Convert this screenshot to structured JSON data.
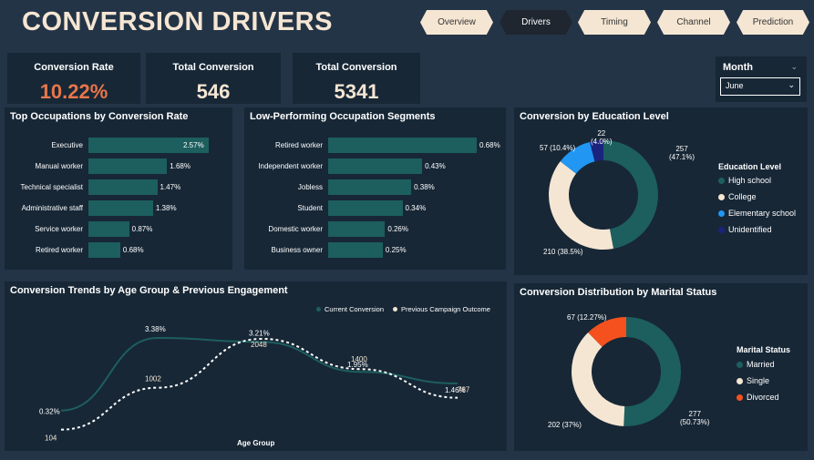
{
  "title": "CONVERSION DRIVERS",
  "nav": [
    "Overview",
    "Drivers",
    "Timing",
    "Channel",
    "Prediction"
  ],
  "nav_active": "Drivers",
  "kpis": [
    {
      "label": "Conversion Rate",
      "value": "10.22%"
    },
    {
      "label": "Total Conversion",
      "value": "546"
    },
    {
      "label": "Total Conversion",
      "value": "5341"
    }
  ],
  "filter": {
    "label": "Month",
    "value": "June"
  },
  "colors": {
    "teal": "#1d5e5e",
    "cream": "#f5e6d3",
    "blue": "#2196f3",
    "navy": "#1a237e",
    "orange": "#e8764a",
    "red": "#f4511e"
  },
  "top_occ": {
    "title": "Top Occupations by Conversion Rate",
    "chart_data": {
      "type": "bar",
      "categories": [
        "Executive",
        "Manual worker",
        "Technical specialist",
        "Administrative staff",
        "Service worker",
        "Retired worker"
      ],
      "values": [
        2.57,
        1.68,
        1.47,
        1.38,
        0.87,
        0.68
      ],
      "labels": [
        "2.57%",
        "1.68%",
        "1.47%",
        "1.38%",
        "0.87%",
        "0.68%"
      ]
    }
  },
  "low_occ": {
    "title": "Low-Performing Occupation Segments",
    "chart_data": {
      "type": "bar",
      "categories": [
        "Retired worker",
        "Independent worker",
        "Jobless",
        "Student",
        "Domestic worker",
        "Business owner"
      ],
      "values": [
        0.68,
        0.43,
        0.38,
        0.34,
        0.26,
        0.25
      ],
      "labels": [
        "0.68%",
        "0.43%",
        "0.38%",
        "0.34%",
        "0.26%",
        "0.25%"
      ]
    }
  },
  "education": {
    "title": "Conversion by Education Level",
    "legend_title": "Education Level",
    "chart_data": {
      "type": "pie",
      "categories": [
        "High school",
        "College",
        "Elementary school",
        "Unidentified"
      ],
      "values": [
        257,
        210,
        57,
        22
      ],
      "labels": [
        "257\n(47.1%)",
        "210 (38.5%)",
        "57 (10.4%)",
        "22\n(4.0%)"
      ],
      "colors": [
        "#1d5e5e",
        "#f5e6d3",
        "#2196f3",
        "#1a237e"
      ]
    }
  },
  "age": {
    "title": "Conversion Trends by Age Group & Previous Engagement",
    "xlabel": "Age Group",
    "chart_data": {
      "type": "line",
      "series": [
        {
          "name": "Current Conversion",
          "values": [
            0.32,
            3.38,
            3.21,
            1.95,
            1.46
          ],
          "labels": [
            "0.32%",
            "3.38%",
            "3.21%",
            "1.95%",
            "1.46%"
          ]
        },
        {
          "name": "Previous Campaign Outcome",
          "values": [
            104,
            1002,
            2048,
            1400,
            787
          ],
          "labels": [
            "104",
            "1002",
            "2048",
            "1400",
            "787"
          ]
        }
      ]
    }
  },
  "marital": {
    "title": "Conversion Distribution by Marital Status",
    "legend_title": "Marital Status",
    "chart_data": {
      "type": "pie",
      "categories": [
        "Married",
        "Single",
        "Divorced"
      ],
      "values": [
        277,
        202,
        67
      ],
      "labels": [
        "277\n(50.73%)",
        "202 (37%)",
        "67 (12.27%)"
      ],
      "colors": [
        "#1d5e5e",
        "#f5e6d3",
        "#f4511e"
      ]
    }
  }
}
